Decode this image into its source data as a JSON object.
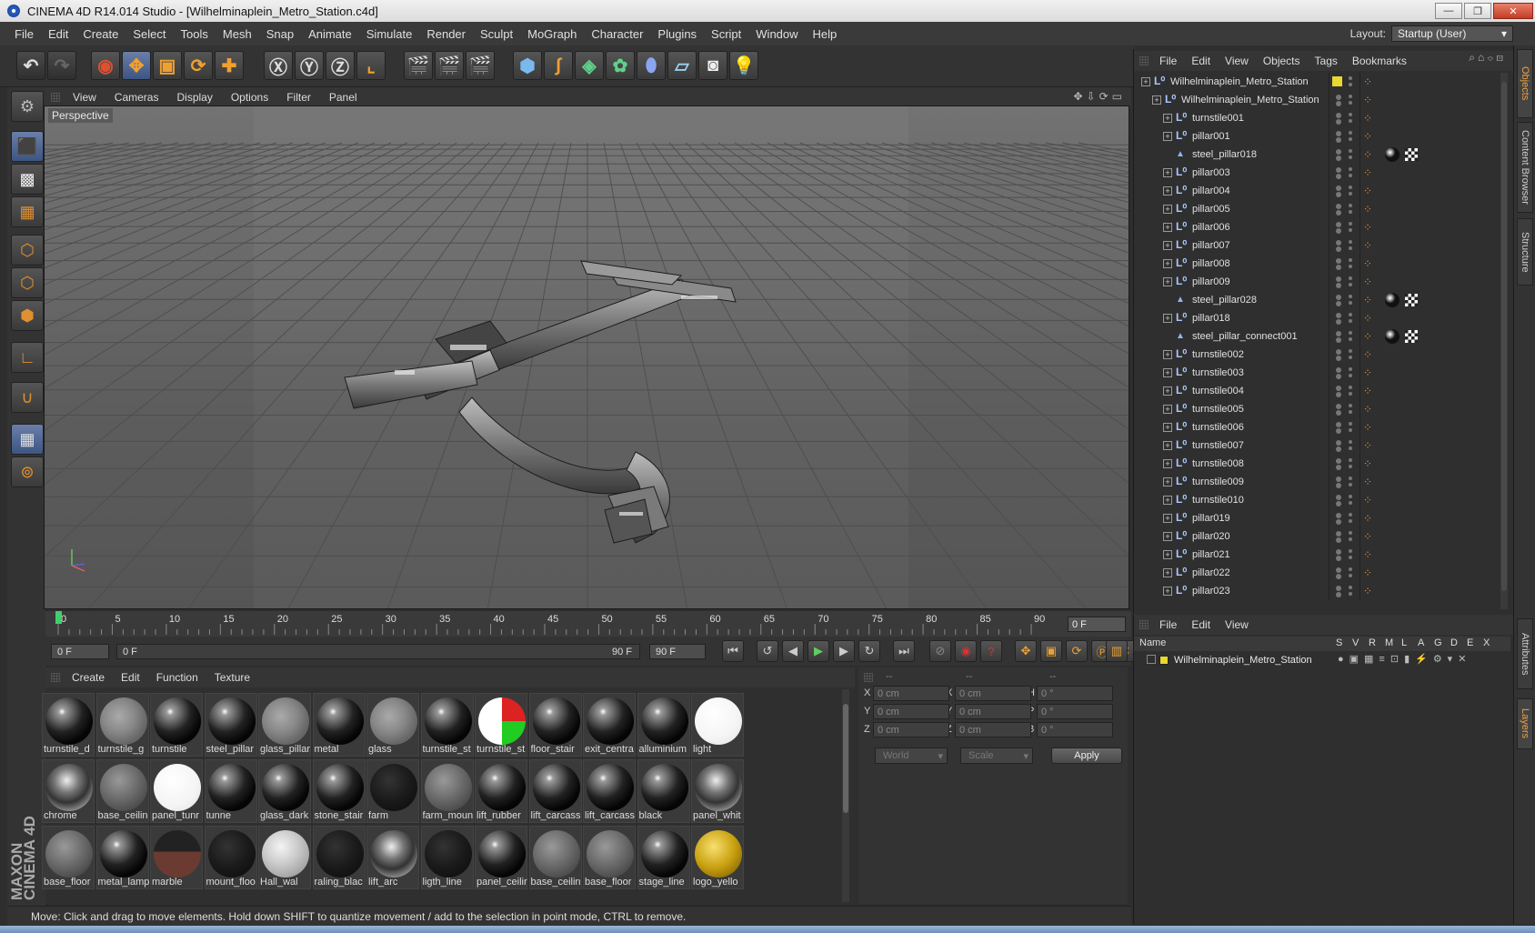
{
  "window": {
    "title": "CINEMA 4D R14.014 Studio - [Wilhelminaplein_Metro_Station.c4d]",
    "buttons": [
      "—",
      "❐",
      "✕"
    ]
  },
  "menubar": [
    "File",
    "Edit",
    "Create",
    "Select",
    "Tools",
    "Mesh",
    "Snap",
    "Animate",
    "Simulate",
    "Render",
    "Sculpt",
    "MoGraph",
    "Character",
    "Plugins",
    "Script",
    "Window",
    "Help"
  ],
  "layout": {
    "label": "Layout:",
    "value": "Startup (User)"
  },
  "viewport": {
    "menu": [
      "View",
      "Cameras",
      "Display",
      "Options",
      "Filter",
      "Panel"
    ],
    "label": "Perspective"
  },
  "timeline": {
    "ticks": [
      "0",
      "5",
      "10",
      "15",
      "20",
      "25",
      "30",
      "35",
      "40",
      "45",
      "50",
      "55",
      "60",
      "65",
      "70",
      "75",
      "80",
      "85",
      "90"
    ],
    "frame_out": "0 F",
    "start_field": "0 F",
    "range_start": "0 F",
    "range_end": "90 F",
    "end_field": "90 F"
  },
  "materials": {
    "menu": [
      "Create",
      "Edit",
      "Function",
      "Texture"
    ],
    "rows": [
      [
        "turnstile_d",
        "turnstile_g",
        "turnstile",
        "steel_pillar",
        "glass_pillar",
        "metal",
        "glass",
        "turnstile_st",
        "turnstile_st",
        "floor_stair",
        "exit_centra",
        "alluminium",
        "light"
      ],
      [
        "chrome",
        "base_ceilin",
        "panel_tunr",
        "tunne",
        "glass_dark",
        "stone_stair",
        "farm",
        "farm_moun",
        "lift_rubber",
        "lift_carcass",
        "lift_carcass",
        "black",
        "panel_whit"
      ],
      [
        "base_floor",
        "metal_lamp",
        "marble",
        "mount_floo",
        "Hall_wal",
        "raling_blac",
        "lift_arc",
        "ligth_line",
        "panel_ceilir",
        "base_ceilin",
        "base_floor",
        "stage_line",
        "logo_yello"
      ]
    ]
  },
  "coordinates": {
    "headers": [
      "--",
      "--",
      "--"
    ],
    "axes1": [
      "X",
      "Y",
      "Z"
    ],
    "axes2": [
      "X",
      "Y",
      "Z"
    ],
    "axes3": [
      "H",
      "P",
      "B"
    ],
    "pos": [
      "0 cm",
      "0 cm",
      "0 cm"
    ],
    "size": [
      "0 cm",
      "0 cm",
      "0 cm"
    ],
    "rot": [
      "0 °",
      "0 °",
      "0 °"
    ],
    "mode1": "World",
    "mode2": "Scale",
    "apply": "Apply"
  },
  "objects": {
    "menu": [
      "File",
      "Edit",
      "View",
      "Objects",
      "Tags",
      "Bookmarks"
    ],
    "items": [
      {
        "name": "Wilhelminaplein_Metro_Station",
        "level": 0,
        "type": "null",
        "yellow": true
      },
      {
        "name": "Wilhelminaplein_Metro_Station",
        "level": 1,
        "type": "null"
      },
      {
        "name": "turnstile001",
        "level": 2,
        "type": "null"
      },
      {
        "name": "pillar001",
        "level": 2,
        "type": "null"
      },
      {
        "name": "steel_pillar018",
        "level": 2,
        "type": "poly",
        "mats": true
      },
      {
        "name": "pillar003",
        "level": 2,
        "type": "null"
      },
      {
        "name": "pillar004",
        "level": 2,
        "type": "null"
      },
      {
        "name": "pillar005",
        "level": 2,
        "type": "null"
      },
      {
        "name": "pillar006",
        "level": 2,
        "type": "null"
      },
      {
        "name": "pillar007",
        "level": 2,
        "type": "null"
      },
      {
        "name": "pillar008",
        "level": 2,
        "type": "null"
      },
      {
        "name": "pillar009",
        "level": 2,
        "type": "null"
      },
      {
        "name": "steel_pillar028",
        "level": 2,
        "type": "poly",
        "mats": true
      },
      {
        "name": "pillar018",
        "level": 2,
        "type": "null"
      },
      {
        "name": "steel_pillar_connect001",
        "level": 2,
        "type": "poly",
        "mats": true
      },
      {
        "name": "turnstile002",
        "level": 2,
        "type": "null"
      },
      {
        "name": "turnstile003",
        "level": 2,
        "type": "null"
      },
      {
        "name": "turnstile004",
        "level": 2,
        "type": "null"
      },
      {
        "name": "turnstile005",
        "level": 2,
        "type": "null"
      },
      {
        "name": "turnstile006",
        "level": 2,
        "type": "null"
      },
      {
        "name": "turnstile007",
        "level": 2,
        "type": "null"
      },
      {
        "name": "turnstile008",
        "level": 2,
        "type": "null"
      },
      {
        "name": "turnstile009",
        "level": 2,
        "type": "null"
      },
      {
        "name": "turnstile010",
        "level": 2,
        "type": "null"
      },
      {
        "name": "pillar019",
        "level": 2,
        "type": "null"
      },
      {
        "name": "pillar020",
        "level": 2,
        "type": "null"
      },
      {
        "name": "pillar021",
        "level": 2,
        "type": "null"
      },
      {
        "name": "pillar022",
        "level": 2,
        "type": "null"
      },
      {
        "name": "pillar023",
        "level": 2,
        "type": "null"
      }
    ]
  },
  "layers": {
    "menu": [
      "File",
      "Edit",
      "View"
    ],
    "columns": [
      "Name",
      "S",
      "V",
      "R",
      "M",
      "L",
      "A",
      "G",
      "D",
      "E",
      "X"
    ],
    "row": "Wilhelminaplein_Metro_Station"
  },
  "right_tabs": [
    "Objects",
    "Content Browser",
    "Structure",
    "Attributes",
    "Layers"
  ],
  "status": "Move: Click and drag to move elements. Hold down SHIFT to quantize movement / add to the selection in point mode, CTRL to remove.",
  "brand": "MAXON CINEMA 4D"
}
